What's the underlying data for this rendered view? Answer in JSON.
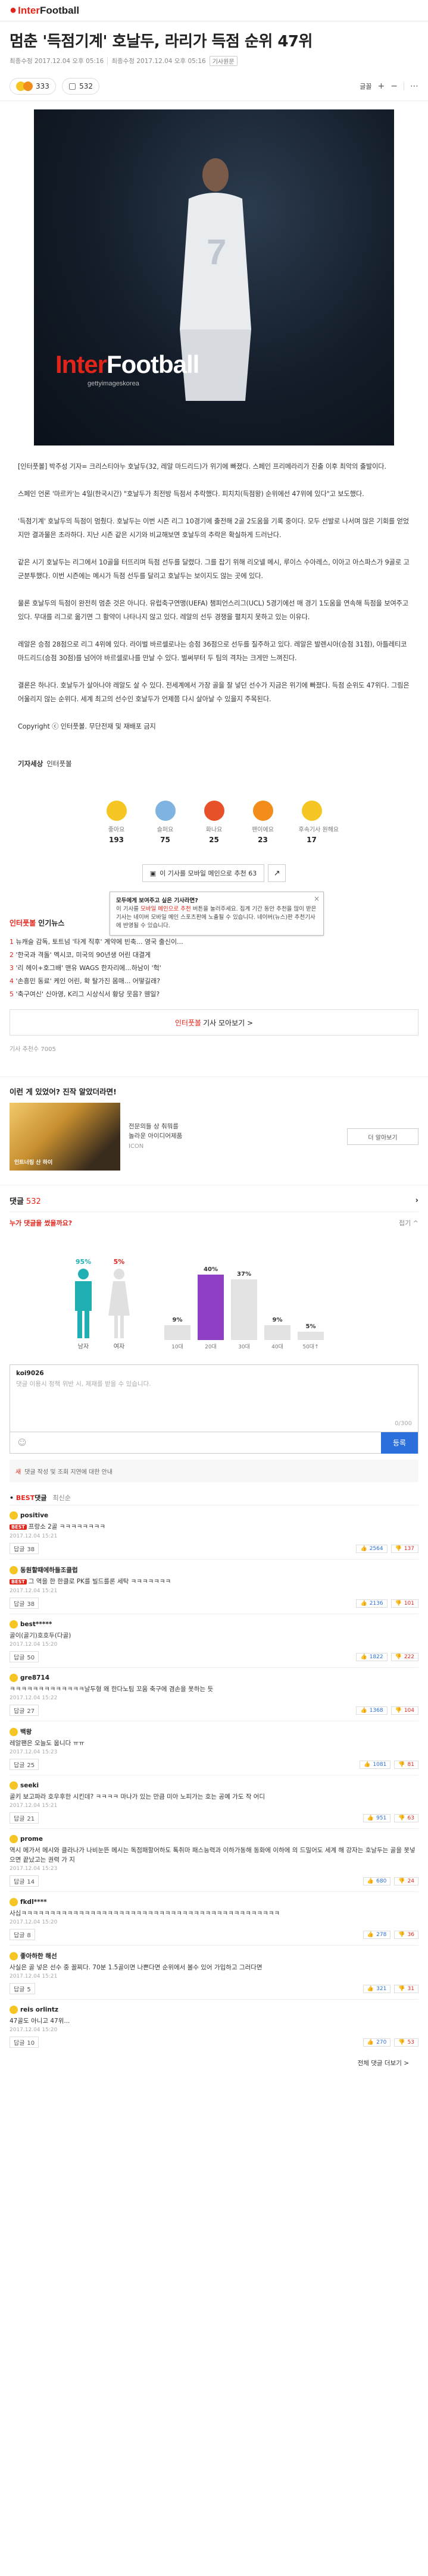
{
  "header": {
    "brand_a": "Inter",
    "brand_b": "Football"
  },
  "article": {
    "title": "멈춘 '득점기계' 호날두, 라리가 득점 순위 47위",
    "meta_date": "최종수정 2017.12.04 오후 05:16",
    "meta_mod": "최종수정 2017.12.04 오후 05:16",
    "meta_tag": "기사원문"
  },
  "toolbar": {
    "reactions": "333",
    "comments": "532",
    "font_btn": "글꼴",
    "plus": "+",
    "minus": "−",
    "share": "⋯"
  },
  "hero": {
    "logo_a": "Inter",
    "logo_b": "Football",
    "logo_sub": "gettyimageskorea"
  },
  "body": [
    "[인터풋볼] 박주성 기자= 크리스티아누 호날두(32, 레알 마드리드)가 위기에 빠졌다. 스페인 프리메라리가 진출 이후 최악의 출발이다.",
    "스페인 언론 '마르카'는 4일(한국시간) \"호날두가 최전방 득점서 추락했다. 피치치(득점왕) 순위에선 47위에 있다\"고 보도했다.",
    "'득점기계' 호날두의 득점이 멈췄다. 호날두는 이번 시즌 리그 10경기에 출전해 2골 2도움을 기록 중이다. 모두 선발로 나서며 많은 기회를 얻었지만 결과물은 초라하다. 지난 시즌 같은 시기와 비교해보면 호날두의 추락은 확실하게 드러난다.",
    "같은 시기 호날두는 리그에서 10골을 터뜨리며 득점 선두를 달렸다. 그를 잡기 위해 리오넬 메시, 루이스 수아레스, 이아고 아스파스가 9골로 고군분투했다. 이번 시즌에는 메시가 득점 선두를 달리고 호날두는 보이지도 않는 곳에 있다.",
    "물론 호날두의 득점이 완전히 멈춘 것은 아니다. 유럽축구연맹(UEFA) 챔피언스리그(UCL) 5경기에선 매 경기 1도움을 연속해 득점을 보여주고 있다. 무대를 리그로 옮기면 그 활약이 나타나지 않고 있다. 레알의 선두 경쟁을 펼치지 못하고 있는 이유다.",
    "레알은 승점 28점으로 리그 4위에 있다. 라이벌 바르셀로나는 승점 36점으로 선두를 질주하고 있다. 레알은 발렌시아(승점 31점), 아틀레티코 마드리드(승점 30점)를 넘어야 바르셀로나를 만날 수 있다. 벌써부터 두 팀의 격차는 크게만 느껴진다.",
    "결론은 하나다. 호날두가 살아나야 레알도 살 수 있다. 전세계에서 가장 골을 잘 넣던 선수가 지금은 위기에 빠졌다. 득점 순위도 47위다. 그림은 어울리지 않는 순위다. 세계 최고의 선수인 호날두가 언제쯤 다시 살아날 수 있을지 주목된다.",
    "Copyright ⓒ 인터풋볼. 무단전재 및 재배포 금지"
  ],
  "reporter": {
    "label": "기자세상",
    "name": "인터풋볼"
  },
  "reactions": [
    {
      "name": "좋아요",
      "count": "193",
      "color": "#f5c623"
    },
    {
      "name": "슬퍼요",
      "count": "75",
      "color": "#7fb3e0"
    },
    {
      "name": "화나요",
      "count": "25",
      "color": "#e8502a"
    },
    {
      "name": "팬이에요",
      "count": "23",
      "color": "#f28c1b"
    },
    {
      "name": "후속기사 원해요",
      "count": "17",
      "color": "#f5c623"
    }
  ],
  "recommend": {
    "label": "이 기사를 모바일 메인으로 추천 63",
    "share": "↗"
  },
  "popup": {
    "title": "모두에게 보여주고 싶은 기사라면?",
    "line1_a": "이 기사를 ",
    "line1_hl": "모바일 메인으로 추천",
    "line1_b": " 버튼을 눌러주세요. 집계 기간 동안 추천을 많이 받은 기사는 네이버 모바일 메인 스포츠판에 노출될 수 있습니다. 네이버(뉴스)판 추천기사에 반영될 수 있습니다.",
    "close": "×"
  },
  "related": {
    "brand": "인터풋볼",
    "title": "인기뉴스",
    "items": [
      {
        "rank": "1",
        "text": "뉴캐슬 감독, 토트넘 '타계 직후' 계약에 빈축... 영국 출신이..."
      },
      {
        "rank": "2",
        "text": "'한국과 격돌' 멕시코, 미국의 90년생 어린 대결게"
      },
      {
        "rank": "3",
        "text": "'리 헤이+호그배' 맨유 WAGS 한자리에...하남이 '헉'"
      },
      {
        "rank": "4",
        "text": "'손흥민 동료' 케인 어린, 확 탈가진 몸매... 어떻길래?"
      },
      {
        "rank": "5",
        "text": "'축구여신' 신아영, K리그 시상식서 황당 웃음? 웬일?"
      }
    ],
    "more_a": "인터풋볼",
    "more_b": " 기사 모아보기 >"
  },
  "views": "기사 추천수 7005",
  "ad": {
    "title": "이런 게 있었어? 진작 알았더라면!",
    "img_caption": "인트너링 산 하이",
    "line1": "전문의들 상 춰뭐를",
    "line2": "놀라운 아이디어제품",
    "source": "ICON",
    "btn": "더 알아보기"
  },
  "comments": {
    "title": "댓글",
    "count": "532",
    "who_title": "누가 댓글을 썼을까요?",
    "who_fold": "접기 ^",
    "gender": [
      {
        "label": "남자",
        "pct": "95%"
      },
      {
        "label": "여자",
        "pct": "5%"
      }
    ],
    "ages": [
      {
        "label": "10대",
        "pct": "9%",
        "v": 9
      },
      {
        "label": "20대",
        "pct": "40%",
        "v": 40
      },
      {
        "label": "30대",
        "pct": "37%",
        "v": 37
      },
      {
        "label": "40대",
        "pct": "9%",
        "v": 9
      },
      {
        "label": "50대↑",
        "pct": "5%",
        "v": 5
      }
    ],
    "input_user": "koi9026",
    "input_placeholder": "댓글 이용시 정책 위반 시, 제재를 받을 수 있습니다.",
    "input_count": "0/300",
    "submit": "등록",
    "notice_badge": "새",
    "notice_text": "댓글 작성 및 조회 지연에 대한 안내",
    "tab_on_a": "BEST",
    "tab_on_b": "댓글",
    "tab_off": "최신순",
    "list": [
      {
        "user": "positive",
        "best": true,
        "text": "프랑소 2골 ㅋㅋㅋㅋㅋㅋㅋㅋ",
        "date": "2017.12.04 15:21",
        "replies": "38",
        "up": "2564",
        "down": "137"
      },
      {
        "user": "동원할때에하들조클럽",
        "best": true,
        "text": "그 역을 한 한클로 PK를 빌드를론 세탁 ㅋㅋㅋㅋㅋㅋㅋ",
        "date": "2017.12.04 15:21",
        "replies": "38",
        "up": "2136",
        "down": "101"
      },
      {
        "user": "best*****",
        "best": false,
        "text": "골이(골기)호호두(다골)",
        "date": "2017.12.04 15:20",
        "replies": "50",
        "up": "1822",
        "down": "222"
      },
      {
        "user": "gre8714",
        "best": false,
        "text": "ㅋㅋㅋㅋㅋㅋㅋㅋㅋㅋㅋㅋㅋ날두형 왜 한다노팀 꼬움 축구에 겸손을 못하는 듯",
        "date": "2017.12.04 15:22",
        "replies": "27",
        "up": "1368",
        "down": "104"
      },
      {
        "user": "백왕",
        "best": false,
        "text": "레알팬은 오늘도 웁니다 ㅠㅠ",
        "date": "2017.12.04 15:23",
        "replies": "25",
        "up": "1081",
        "down": "81"
      },
      {
        "user": "seeki",
        "best": false,
        "text": "골키 보고파라 호우후한 시킨데? ㅋㅋㅋㅋ 마나가 있는 만큼 미아 노피가는 호는 공예 가도 작 어디",
        "date": "2017.12.04 15:21",
        "replies": "21",
        "up": "951",
        "down": "63"
      },
      {
        "user": "prome",
        "best": false,
        "text": "역시 메가서 메시와 클라나가 나비눈뜬 메시는 독점패할어하도 톡취마 패스능력과 이하가동해 동화에 이하에 의 드밀어도 세계 해 강자는 호날두는 골을 못넣으면 끝났고는 권력 가 지",
        "date": "2017.12.04 15:23",
        "replies": "14",
        "up": "680",
        "down": "24"
      },
      {
        "user": "fkdl****",
        "best": false,
        "text": "사십ㅋㅋㅋㅋㅋㅋㅋㅋㅋㅋㅋㅋㅋㅋㅋㅋㅋㅋㅋㅋㅋㅋㅋㅋㅋㅋㅋㅋㅋㅋㅋㅋㅋㅋㅋㅋㅋㅋㅋㅋㅋㅋㅋㅋㅋ",
        "date": "2017.12.04 15:20",
        "replies": "8",
        "up": "278",
        "down": "36"
      },
      {
        "user": "좋아하한 해선",
        "best": false,
        "text": "사실은 골 넣은 선수 중 꼴찌다. 70분 1.5골이면 나쁜다면 순위에서 볼수 있어 가입하고 그러다면",
        "date": "2017.12.04 15:21",
        "replies": "5",
        "up": "321",
        "down": "31"
      },
      {
        "user": "reis orlintz",
        "best": false,
        "text": "47골도 아니고 47위...",
        "date": "2017.12.04 15:20",
        "replies": "10",
        "up": "270",
        "down": "53"
      }
    ],
    "load_more": "전체 댓글 더보기 >"
  }
}
